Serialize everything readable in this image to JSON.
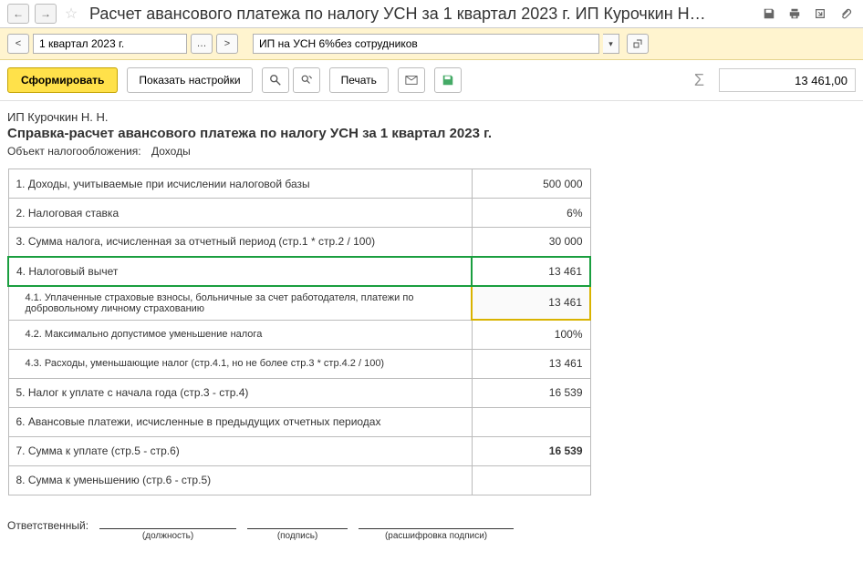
{
  "title": "Расчет  авансового платежа по налогу УСН за 1 квартал 2023 г. ИП Курочкин Н…",
  "period": {
    "value": "1 квартал 2023 г.",
    "org": "ИП на УСН 6%без сотрудников"
  },
  "toolbar": {
    "form": "Сформировать",
    "settings": "Показать настройки",
    "print": "Печать",
    "total": "13 461,00"
  },
  "report": {
    "org": "ИП Курочкин Н. Н.",
    "title": "Справка-расчет авансового платежа по налогу УСН за 1 квартал 2023 г.",
    "obj_label": "Объект налогообложения:",
    "obj_value": "Доходы"
  },
  "rows": {
    "r1": {
      "label": "1. Доходы, учитываемые при исчислении налоговой базы",
      "val": "500 000"
    },
    "r2": {
      "label": "2. Налоговая ставка",
      "val": "6%"
    },
    "r3": {
      "label": "3. Сумма налога, исчисленная за отчетный период (стр.1 * стр.2 / 100)",
      "val": "30 000"
    },
    "r4": {
      "label": "4. Налоговый вычет",
      "val": "13 461"
    },
    "r41": {
      "label": "4.1. Уплаченные страховые взносы, больничные за счет работодателя, платежи по добровольному личному страхованию",
      "val": "13 461"
    },
    "r42": {
      "label": "4.2. Максимально допустимое уменьшение налога",
      "val": "100%"
    },
    "r43": {
      "label": "4.3. Расходы, уменьшающие налог (стр.4.1, но не более стр.3 * стр.4.2 / 100)",
      "val": "13 461"
    },
    "r5": {
      "label": "5. Налог к уплате с начала года (стр.3 - стр.4)",
      "val": "16 539"
    },
    "r6": {
      "label": "6. Авансовые платежи, исчисленные в предыдущих отчетных периодах",
      "val": ""
    },
    "r7": {
      "label": "7. Сумма к уплате (стр.5 - стр.6)",
      "val": "16 539"
    },
    "r8": {
      "label": "8. Сумма к уменьшению (стр.6 - стр.5)",
      "val": ""
    }
  },
  "signature": {
    "label": "Ответственный:",
    "pos": "(должность)",
    "sign": "(подпись)",
    "name": "(расшифровка подписи)"
  }
}
